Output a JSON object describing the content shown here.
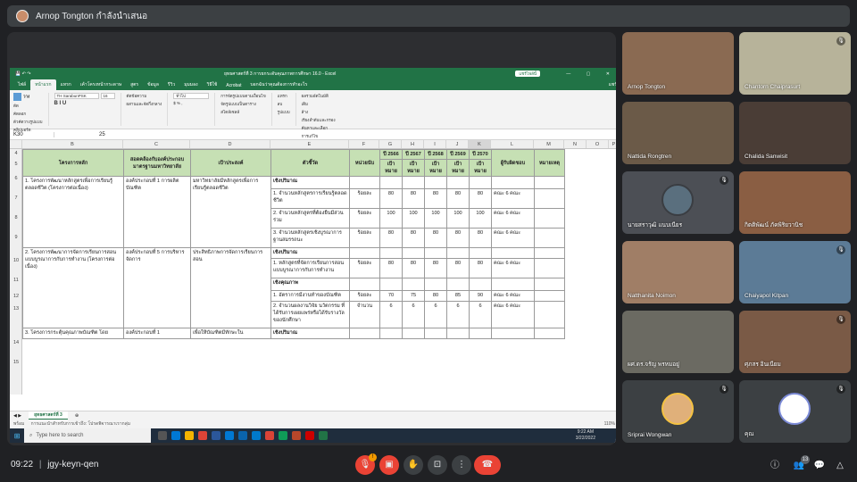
{
  "presenter": {
    "label": "Arnop Tongton กำลังนำเสนอ"
  },
  "excel": {
    "title": "ยุทธศาสตร์ที่ 3 การยกระดับคุณภาพการศึกษา 16.0 - Excel",
    "share_btn": "แชร์ไฟล์นี้",
    "window_controls": "— ▢ ✕",
    "tabs": [
      "ไฟล์",
      "หน้าแรก",
      "แทรก",
      "เค้าโครงหน้ากระดาษ",
      "สูตร",
      "ข้อมูล",
      "รีวิว",
      "มุมมอง",
      "วิธีใช้",
      "Acrobat",
      "บอกฉันว่าคุณต้องการทำอะไร"
    ],
    "tell_me": "บอกฉันว่าคุณต้องการทำอะไร",
    "share_tab": "แชร์",
    "ribbon": {
      "font_name": "TH SarabunPSK",
      "font_size": "16",
      "paste": "วาง",
      "cut": "ตัด",
      "copy": "คัดลอก",
      "format_painter": "ตัวคัดวางรูปแบบ",
      "clipboard": "คลิปบอร์ด",
      "wrap_text": "ตัดข้อความ",
      "merge": "ผสานและจัดกึ่งกลาง",
      "number_format": "ทั่วไป",
      "cond_format": "การจัดรูปแบบตามเงื่อนไข",
      "format_table": "จัดรูปแบบเป็นตาราง",
      "cell_styles": "สไตล์เซลล์",
      "insert": "แทรก",
      "delete": "ลบ",
      "format": "รูปแบบ",
      "autosum": "ผลรวมอัตโนมัติ",
      "fill": "เติม",
      "clear": "ล้าง",
      "sort_filter": "เรียงลำดับและกรอง",
      "find_select": "ค้นหาและเลือก",
      "editing": "การแก้ไข"
    },
    "cell_ref": "K30",
    "formula_value": "25",
    "columns": [
      "B",
      "C",
      "D",
      "E",
      "F",
      "G",
      "H",
      "I",
      "J",
      "K",
      "L",
      "M",
      "N",
      "O",
      "P"
    ],
    "header_row": [
      "โครงการหลัก",
      "สอดคล้องกับองค์ประกอบมาตรฐานมหาวิทยาลัย",
      "เป้าประสงค์",
      "ตัวชี้วัด",
      "หน่วยนับ",
      "ปี 2566",
      "ปี 2567",
      "ปี 2568",
      "ปี 2569",
      "ปี 2570",
      "ผู้รับผิดชอบ",
      "หมายเหตุ"
    ],
    "subheader": "เป้าหมาย",
    "row_numbers": [
      "4",
      "5",
      "6",
      "7",
      "8",
      "9",
      "10",
      "11",
      "12",
      "13",
      "14",
      "15"
    ],
    "rows": {
      "p1_project": "1. โครงการพัฒนาหลักสูตรเพื่อการเรียนรู้ตลอดชีวิต (โครงการต่อเนื่อง)",
      "p1_std": "องค์ประกอบที่ 1 การผลิตบัณฑิต",
      "p1_goal": "มหาวิทยาลัยมีหลักสูตรเพื่อการเรียนรู้ตลอดชีวิต",
      "quant": "เชิงปริมาณ",
      "qual": "เชิงคุณภาพ",
      "k1": "1. จำนวนหลักสูตรการเรียนรู้ตลอดชีวิต",
      "k1_vals": [
        "ร้อยละ",
        "80",
        "80",
        "80",
        "80",
        "80",
        "คณะ 6 คณะ"
      ],
      "k2": "2. จำนวนหลักสูตรที่ต้องยืนมีส่วนร่วม",
      "k2_vals": [
        "ร้อยละ",
        "100",
        "100",
        "100",
        "100",
        "100",
        "คณะ 6 คณะ"
      ],
      "k3": "3. จำนวนหลักสูตรเชิงบูรณาการฐานสมรรถนะ",
      "k3_vals": [
        "ร้อยละ",
        "80",
        "80",
        "80",
        "80",
        "80",
        "คณะ 6 คณะ"
      ],
      "p2_project": "2. โครงการพัฒนาการจัดการเรียนการสอนแบบบูรณาการกับการทำงาน (โครงการต่อเนื่อง)",
      "p2_std": "องค์ประกอบที่ 5 การบริหารจัดการ",
      "p2_goal": "ประสิทธิภาพการจัดการเรียนการสอน",
      "k4": "1. หลักสูตรที่จัดการเรียนการสอนแบบบูรณาการกับการทำงาน",
      "k4_vals": [
        "ร้อยละ",
        "80",
        "80",
        "80",
        "80",
        "80",
        "คณะ 6 คณะ"
      ],
      "k5": "1. อัตราการมีงานทำของบัณฑิต",
      "k5_vals": [
        "ร้อยละ",
        "70",
        "75",
        "80",
        "85",
        "90",
        "คณะ 6 คณะ"
      ],
      "k6": "2. จำนวนผลงานวิจัย นวัตกรรม ที่ได้รับการเผยแพร่หรือได้รับรางวัลของนักศึกษา",
      "k6_vals": [
        "จำนวน",
        "6",
        "6",
        "6",
        "6",
        "6",
        "คณะ 6 คณะ"
      ],
      "p3_project": "3. โครงการกระตุ้นคุณภาพบัณฑิต โดย",
      "p3_std": "องค์ประกอบที่ 1",
      "p3_goal": "เพื่อให้บัณฑิตมีทักษะใน"
    },
    "sheet_tab": "ยุทธศาสตร์ที่ 3",
    "status_left": "พร้อม",
    "status_hint": "การแนะนำสำหรับการเข้าถึง: โปรดพิจารณาเรากลุ่ม",
    "zoom": "110%",
    "taskbar_search": "Type here to search",
    "clock_time": "9:22 AM",
    "clock_date": "3/22/2022"
  },
  "participants": [
    {
      "name": "Arnop Tongton",
      "muted": false,
      "bg": "#8a6a52"
    },
    {
      "name": "Chantorn Chaiprasurt",
      "muted": true,
      "bg": "#b7b39a"
    },
    {
      "name": "Nattida Rongtren",
      "muted": false,
      "bg": "#6b5a48"
    },
    {
      "name": "Chalida Sanwisit",
      "muted": false,
      "bg": "#4a3d36"
    },
    {
      "name": "นายสราวุฒิ แนบเนียร",
      "muted": true,
      "bg": "#4c4f55"
    },
    {
      "name": "กิตติพัฒน์ ภัคพิริยวานิช",
      "muted": false,
      "bg": "#8a5e43"
    },
    {
      "name": "Natthanita Noimon",
      "muted": false,
      "bg": "#a07e66"
    },
    {
      "name": "Chaiyapol Kitpan",
      "muted": true,
      "bg": "#5c7b96"
    },
    {
      "name": "ผศ.ดร.จรัญ พรหมอยู่",
      "muted": false,
      "bg": "#6b6a62"
    },
    {
      "name": "ศุภสร อินเนียม",
      "muted": true,
      "bg": "#7a5a46"
    },
    {
      "name": "Sriprai Wongwan",
      "muted": true,
      "bg": "#3c4043"
    },
    {
      "name": "คุณ",
      "muted": true,
      "bg": "#3c4043"
    }
  ],
  "meeting": {
    "time": "09:22",
    "code": "jgy-keyn-qen",
    "raise_badge": "!",
    "people_count": "13"
  },
  "colors": {
    "excel_green": "#217346",
    "header_fill": "#c6e0b4",
    "hangup": "#ea4335"
  }
}
